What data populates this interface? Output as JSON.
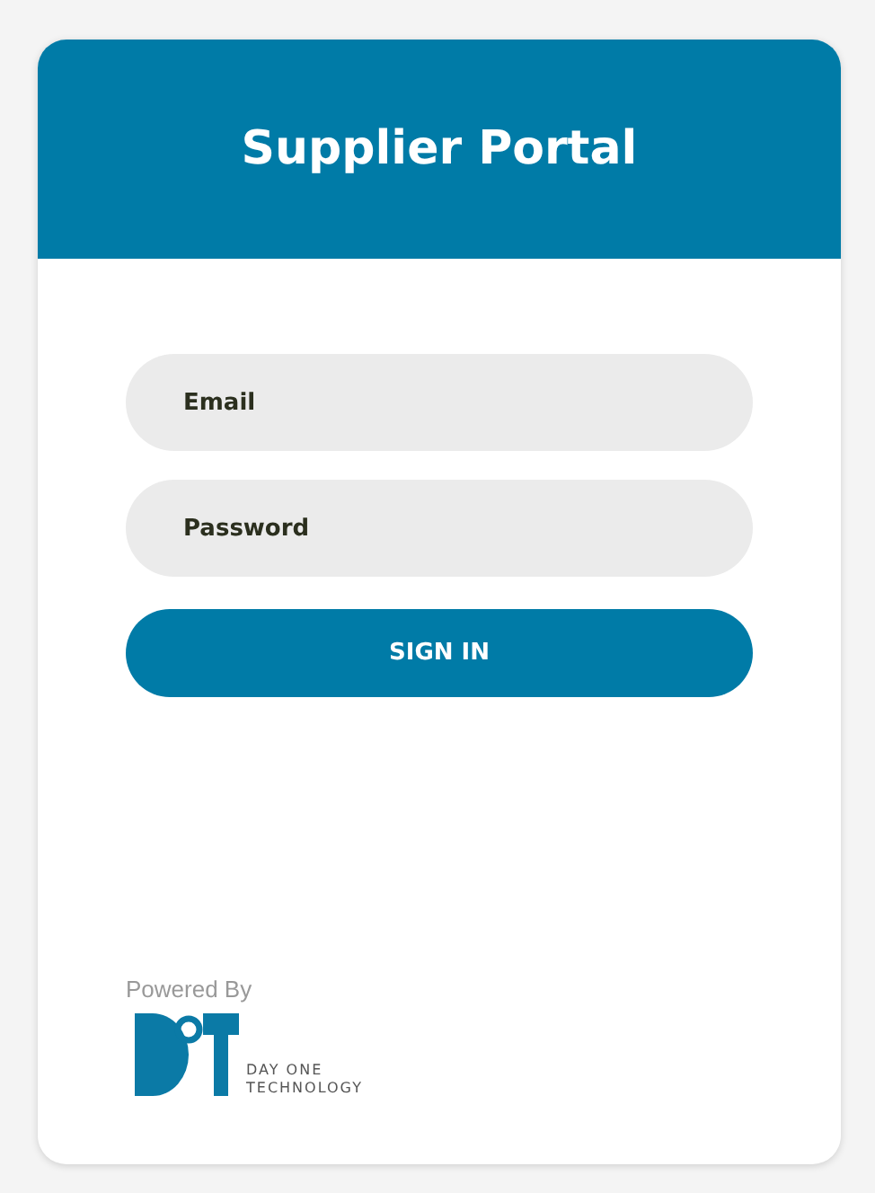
{
  "header": {
    "title": "Supplier Portal"
  },
  "fields": [
    {
      "placeholder": "Email"
    },
    {
      "placeholder": "Password"
    }
  ],
  "submit": {
    "label": "SIGN IN"
  },
  "footer": {
    "powered_by": "Powered By",
    "logo_lines": [
      "DAY ONE",
      "TECHNOLOGY"
    ]
  }
}
